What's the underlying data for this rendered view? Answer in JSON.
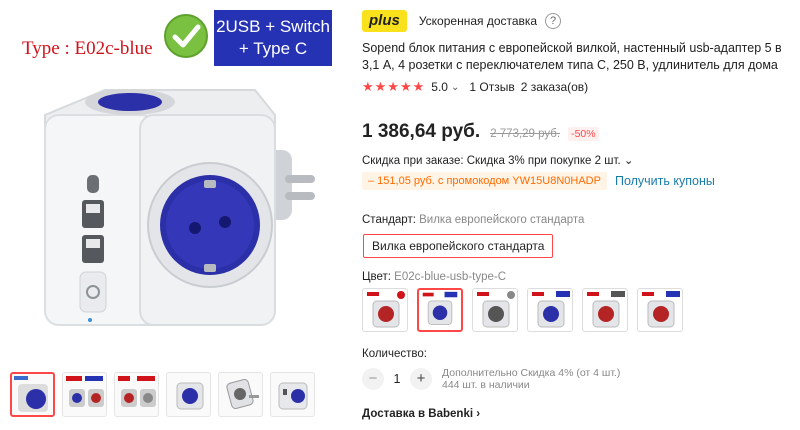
{
  "gallery": {
    "type_label": "Type : E02c-blue",
    "feature_banner": [
      "2USB + Switch",
      "+ Type C"
    ],
    "icons": {
      "check": "checkmark-icon"
    },
    "thumbnail_count": 6,
    "active_thumbnail": 0
  },
  "product": {
    "plus_logo": "plus",
    "delivery": "Ускоренная доставка",
    "help": "?",
    "title": "Sopend блок питания с европейской вилкой, настенный usb-адаптер 5 в 3,1 А, 4 розетки с переключателем типа С, 250 В, удлинитель для дома",
    "stars": "★★★★★",
    "rating": "5.0",
    "reviews": "1 Отзыв",
    "orders": "2 заказа(ов)",
    "price": "1 386,64 руб.",
    "old_price": "2 773,29 руб.",
    "discount": "-50%",
    "order_discount": "Скидка при заказе: Скидка 3% при покупке 2 шт. ⌄",
    "coupon": "– 151,05 руб. с промокодом YW15U8N0HADP",
    "get_coupons": "Получить купоны",
    "standard_label": "Стандарт:",
    "standard_selected": "Вилка европейского стандарта",
    "standard_option": "Вилка европейского стандарта",
    "color_label": "Цвет:",
    "color_selected": "E02c-blue-usb-type-C",
    "selected_swatch": 1,
    "qty_label": "Количество:",
    "qty_minus": "−",
    "qty_value": "1",
    "qty_plus": "+",
    "qty_extra": "Дополнительно Скидка 4% (от 4 шт.)",
    "qty_stock": "444 шт. в наличии",
    "delivery_seller": "Доставка в Babenki ›"
  },
  "colors": {
    "accent": "#ff4747",
    "banner": "#2632b4",
    "socket_blue": "#2b2fa8",
    "socket_red": "#b52424",
    "link": "#1a7ba8",
    "coupon": "#ff6a00"
  }
}
